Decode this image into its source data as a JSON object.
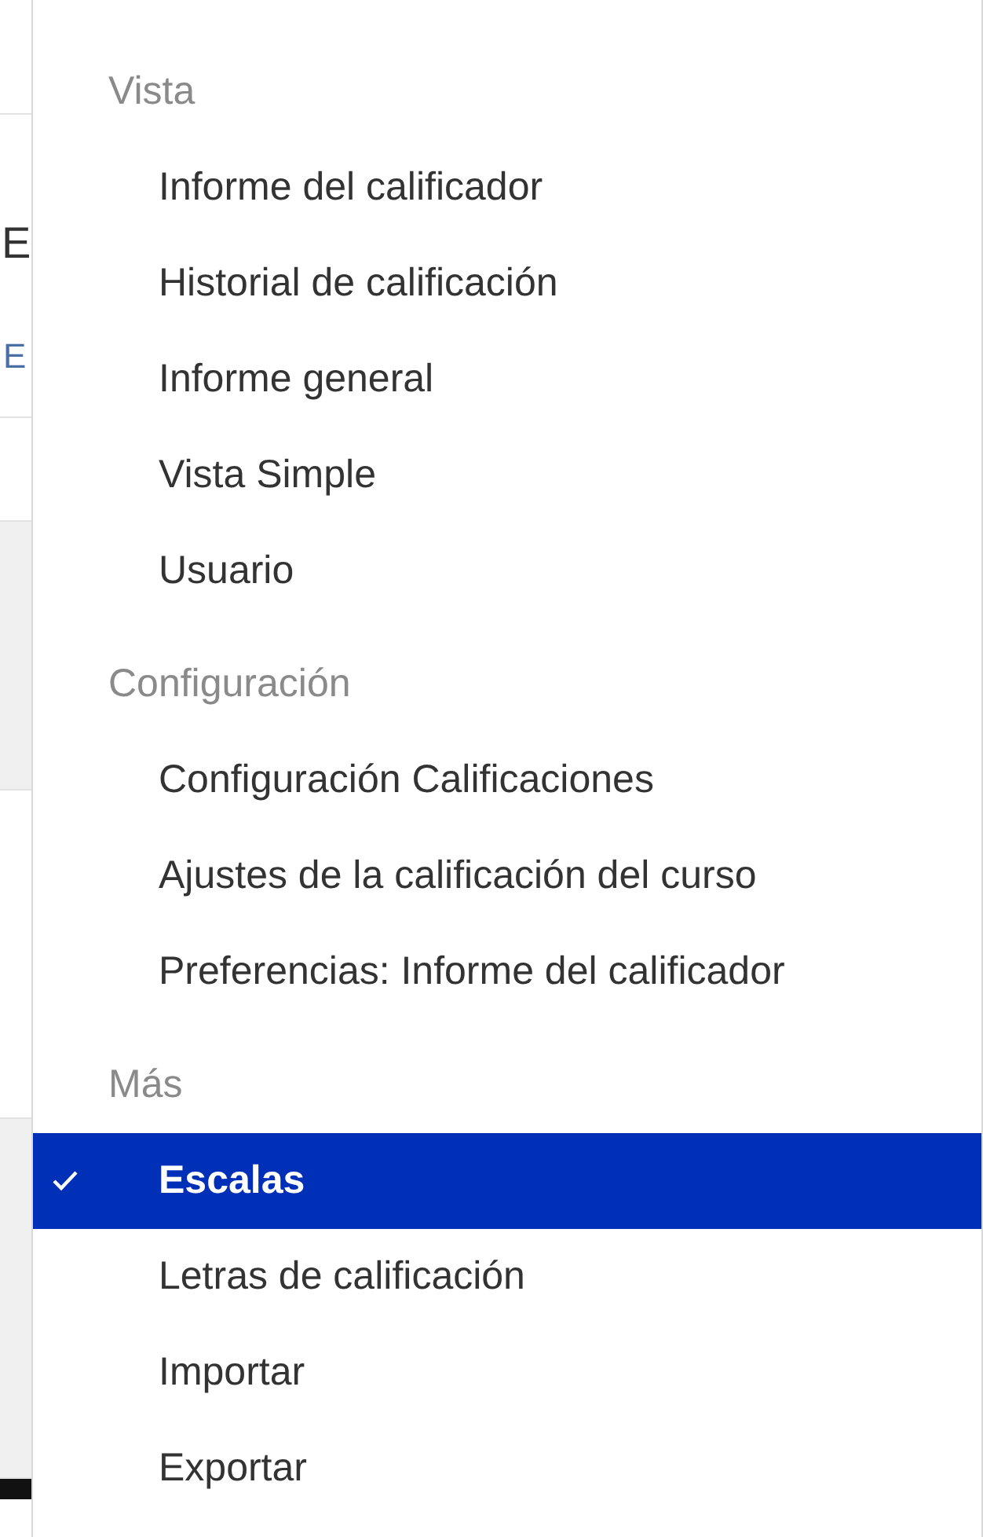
{
  "background": {
    "heading": "E",
    "subheading": "E"
  },
  "menu": {
    "sections": [
      {
        "header": "Vista",
        "items": [
          {
            "label": "Informe del calificador",
            "selected": false
          },
          {
            "label": "Historial de calificación",
            "selected": false
          },
          {
            "label": "Informe general",
            "selected": false
          },
          {
            "label": "Vista Simple",
            "selected": false
          },
          {
            "label": "Usuario",
            "selected": false
          }
        ]
      },
      {
        "header": "Configuración",
        "items": [
          {
            "label": "Configuración Calificaciones",
            "selected": false
          },
          {
            "label": "Ajustes de la calificación del curso",
            "selected": false
          },
          {
            "label": "Preferencias: Informe del calificador",
            "selected": false
          }
        ]
      },
      {
        "header": "Más",
        "items": [
          {
            "label": "Escalas",
            "selected": true
          },
          {
            "label": "Letras de calificación",
            "selected": false
          },
          {
            "label": "Importar",
            "selected": false
          },
          {
            "label": "Exportar",
            "selected": false
          }
        ]
      }
    ]
  }
}
